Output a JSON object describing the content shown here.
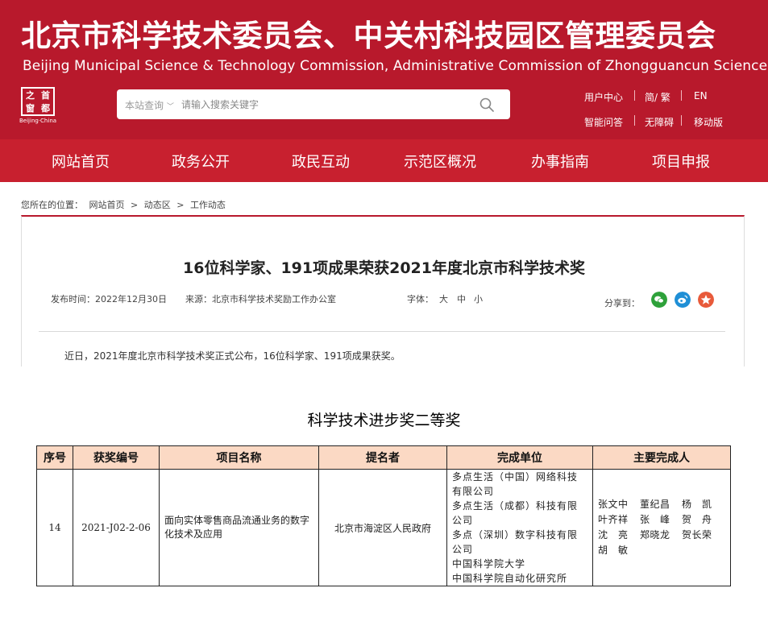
{
  "header": {
    "title_cn": "北京市科学技术委员会、中关村科技园区管理委员会",
    "title_en": "Beijing Municipal Science & Technology Commission, Administrative Commission of Zhongguancun Science Park",
    "logo": {
      "chars": [
        "之",
        "首",
        "窗",
        "都"
      ],
      "caption": "Beijing·China"
    },
    "search": {
      "scope": "本站查询",
      "placeholder": "请输入搜索关键字"
    },
    "utils_row1": [
      "用户中心",
      "简/ 繁",
      "EN"
    ],
    "utils_row2": [
      "智能问答",
      "无障碍",
      "移动版"
    ]
  },
  "nav": [
    "网站首页",
    "政务公开",
    "政民互动",
    "示范区概况",
    "办事指南",
    "项目申报"
  ],
  "breadcrumb": {
    "label": "您所在的位置：",
    "items": [
      "网站首页",
      ">",
      "动态区",
      ">",
      "工作动态"
    ]
  },
  "article": {
    "title": "16位科学家、191项成果荣获2021年度北京市科学技术奖",
    "publish_label": "发布时间：",
    "publish_date": "2022年12月30日",
    "source_label": "来源：",
    "source": "北京市科学技术奖励工作办公室",
    "font_label": "字体：",
    "font_sizes": [
      "大",
      "中",
      "小"
    ],
    "share_label": "分享到：",
    "share_icons": [
      "wechat-icon",
      "weibo-icon",
      "qzone-icon"
    ],
    "intro": "近日，2021年度北京市科学技术奖正式公布，16位科学家、191项成果获奖。"
  },
  "award": {
    "section_title": "科学技术进步奖二等奖",
    "columns": [
      "序号",
      "获奖编号",
      "项目名称",
      "提名者",
      "完成单位",
      "主要完成人"
    ],
    "row": {
      "no": "14",
      "code": "2021-J02-2-06",
      "project": "面向实体零售商品流通业务的数字化技术及应用",
      "nominator": "北京市海淀区人民政府",
      "units": [
        "多点生活（中国）网络科技",
        "有限公司",
        "多点生活（成都）科技有限",
        "公司",
        "多点（深圳）数字科技有限",
        "公司",
        "中国科学院大学",
        "中国科学院自动化研究所"
      ],
      "people": [
        [
          "张文中",
          "董纪昌",
          "杨　凯"
        ],
        [
          "叶齐祥",
          "张　峰",
          "贺　舟"
        ],
        [
          "沈　亮",
          "郑晓龙",
          "贺长荣"
        ],
        [
          "胡　敏"
        ]
      ]
    }
  },
  "colors": {
    "brand_red": "#b8192c",
    "nav_red": "#c8202f",
    "table_header": "#fbd9c4",
    "wechat": "#2ea13a",
    "weibo": "#1f8fd6",
    "qzone": "#e85a3a"
  }
}
